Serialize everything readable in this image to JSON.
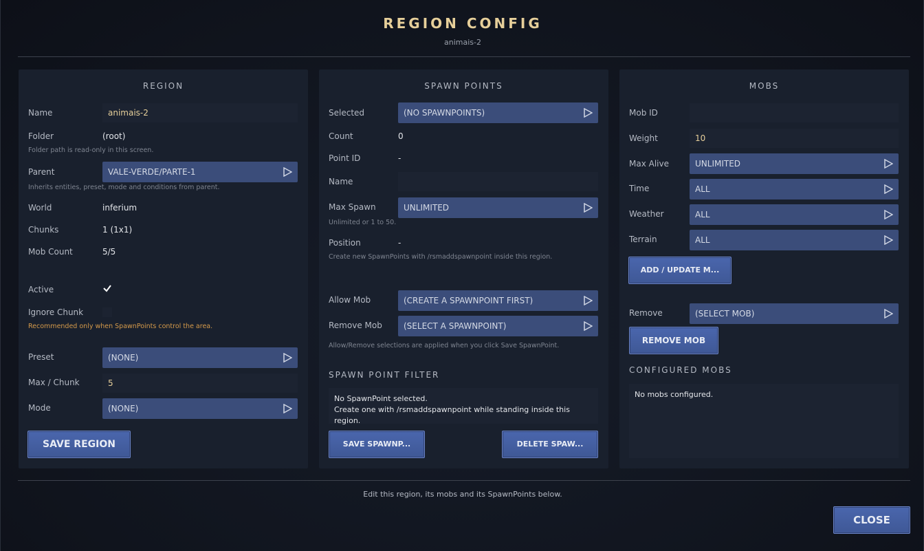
{
  "header": {
    "title": "REGION CONFIG",
    "subtitle": "animais-2"
  },
  "region": {
    "title": "REGION",
    "name_label": "Name",
    "name_value": "animais-2",
    "folder_label": "Folder",
    "folder_value": "(root)",
    "folder_hint": "Folder path is read-only in this screen.",
    "parent_label": "Parent",
    "parent_value": "VALE-VERDE/PARTE-1",
    "parent_hint": "Inherits entities, preset, mode and conditions from parent.",
    "world_label": "World",
    "world_value": "inferium",
    "chunks_label": "Chunks",
    "chunks_value": "1 (1x1)",
    "mobcount_label": "Mob Count",
    "mobcount_value": "5/5",
    "active_label": "Active",
    "active_checked": true,
    "ignore_label": "Ignore Chunk",
    "ignore_checked": false,
    "ignore_warn": "Recommended only when SpawnPoints control the area.",
    "preset_label": "Preset",
    "preset_value": "(NONE)",
    "maxchunk_label": "Max / Chunk",
    "maxchunk_value": "5",
    "mode_label": "Mode",
    "mode_value": "(NONE)",
    "save_button": "SAVE REGION"
  },
  "spawn": {
    "title": "SPAWN POINTS",
    "selected_label": "Selected",
    "selected_value": "(NO SPAWNPOINTS)",
    "count_label": "Count",
    "count_value": "0",
    "pointid_label": "Point ID",
    "pointid_value": "-",
    "name_label": "Name",
    "name_value": "",
    "maxspawn_label": "Max Spawn",
    "maxspawn_value": "UNLIMITED",
    "maxspawn_hint": "Unlimited or 1 to 50.",
    "position_label": "Position",
    "position_value": "-",
    "position_hint": "Create new SpawnPoints with /rsmaddspawnpoint inside this region.",
    "allow_label": "Allow Mob",
    "allow_value": "(CREATE A SPAWNPOINT FIRST)",
    "remove_label": "Remove Mob",
    "remove_value": "(SELECT A SPAWNPOINT)",
    "allow_hint": "Allow/Remove selections are applied when you click Save SpawnPoint.",
    "filter_title": "SPAWN POINT FILTER",
    "filter_line1": "No SpawnPoint selected.",
    "filter_line2": "Create one with /rsmaddspawnpoint while standing inside this region.",
    "save_button": "SAVE SPAWNP...",
    "delete_button": "DELETE SPAW..."
  },
  "mobs": {
    "title": "MOBS",
    "mobid_label": "Mob ID",
    "mobid_value": "",
    "weight_label": "Weight",
    "weight_value": "10",
    "maxalive_label": "Max Alive",
    "maxalive_value": "UNLIMITED",
    "time_label": "Time",
    "time_value": "ALL",
    "weather_label": "Weather",
    "weather_value": "ALL",
    "terrain_label": "Terrain",
    "terrain_value": "ALL",
    "add_button": "ADD / UPDATE M...",
    "remove_label": "Remove",
    "remove_value": "(SELECT MOB)",
    "remove_button": "REMOVE MOB",
    "configured_title": "CONFIGURED MOBS",
    "configured_empty": "No mobs configured."
  },
  "footer": {
    "hint": "Edit this region, its mobs and its SpawnPoints below.",
    "close_button": "CLOSE"
  },
  "colors": {
    "accent": "#e6cf9a",
    "button": "#4a66ad",
    "select": "#3b4d7a",
    "warn": "#d59a4a"
  }
}
